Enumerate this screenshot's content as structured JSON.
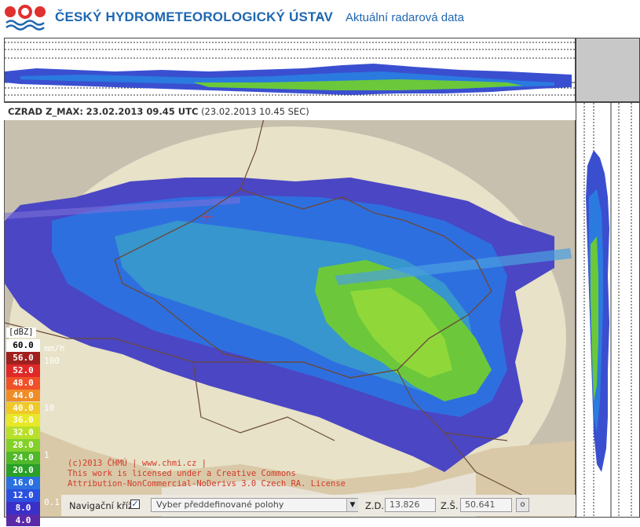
{
  "header": {
    "org_name": "ČESKÝ HYDROMETEOROLOGICKÝ ÚSTAV",
    "separator": "-",
    "subtitle": "Aktuální radarová data",
    "logo_icon": "chmu-logo-icon"
  },
  "map": {
    "product": "CZRAD Z_MAX:",
    "obs_time": "23.02.2013 09.45 UTC",
    "local_time": "(23.02.2013 10.45 SEC)"
  },
  "legend": {
    "unit": "[dBZ]",
    "rain_unit": "mm/h",
    "levels": [
      {
        "dbz": "60.0",
        "color": "#ffffff",
        "text": "#000000"
      },
      {
        "dbz": "56.0",
        "color": "#a02020",
        "text": "#ffffff"
      },
      {
        "dbz": "52.0",
        "color": "#e02828",
        "text": "#ffffff"
      },
      {
        "dbz": "48.0",
        "color": "#f05028",
        "text": "#ffffff"
      },
      {
        "dbz": "44.0",
        "color": "#f08c28",
        "text": "#ffffff"
      },
      {
        "dbz": "40.0",
        "color": "#f0c828",
        "text": "#ffffff"
      },
      {
        "dbz": "36.0",
        "color": "#e8e828",
        "text": "#ffffff"
      },
      {
        "dbz": "32.0",
        "color": "#b8e02a",
        "text": "#ffffff"
      },
      {
        "dbz": "28.0",
        "color": "#84d02a",
        "text": "#ffffff"
      },
      {
        "dbz": "24.0",
        "color": "#50b82a",
        "text": "#ffffff"
      },
      {
        "dbz": "20.0",
        "color": "#2aa028",
        "text": "#ffffff"
      },
      {
        "dbz": "16.0",
        "color": "#2a70e0",
        "text": "#ffffff"
      },
      {
        "dbz": "12.0",
        "color": "#2a50e0",
        "text": "#ffffff"
      },
      {
        "dbz": "8.0",
        "color": "#3a30c8",
        "text": "#ffffff"
      },
      {
        "dbz": "4.0",
        "color": "#5a2aa8",
        "text": "#ffffff"
      }
    ],
    "rain_rates": [
      "100",
      "10",
      "1",
      "0.1"
    ]
  },
  "copyright": {
    "line1": "(c)2013 ČHMÚ | www.chmi.cz |",
    "line2": "This work is licensed under a Creative Commons",
    "line3": "Attribution-NonCommercial-NoDerivs 3.0 Czech RA. License"
  },
  "nav": {
    "cross_label": "Navigační kříž:",
    "cross_checked": "☑",
    "preset_placeholder": "Vyber předdefinované polohy",
    "select_arrow": "▼",
    "lon_label": "Z.D.",
    "lon_value": "13.826",
    "lat_label": "Z.Š.",
    "lat_value": "50.641",
    "go_label": "o"
  }
}
